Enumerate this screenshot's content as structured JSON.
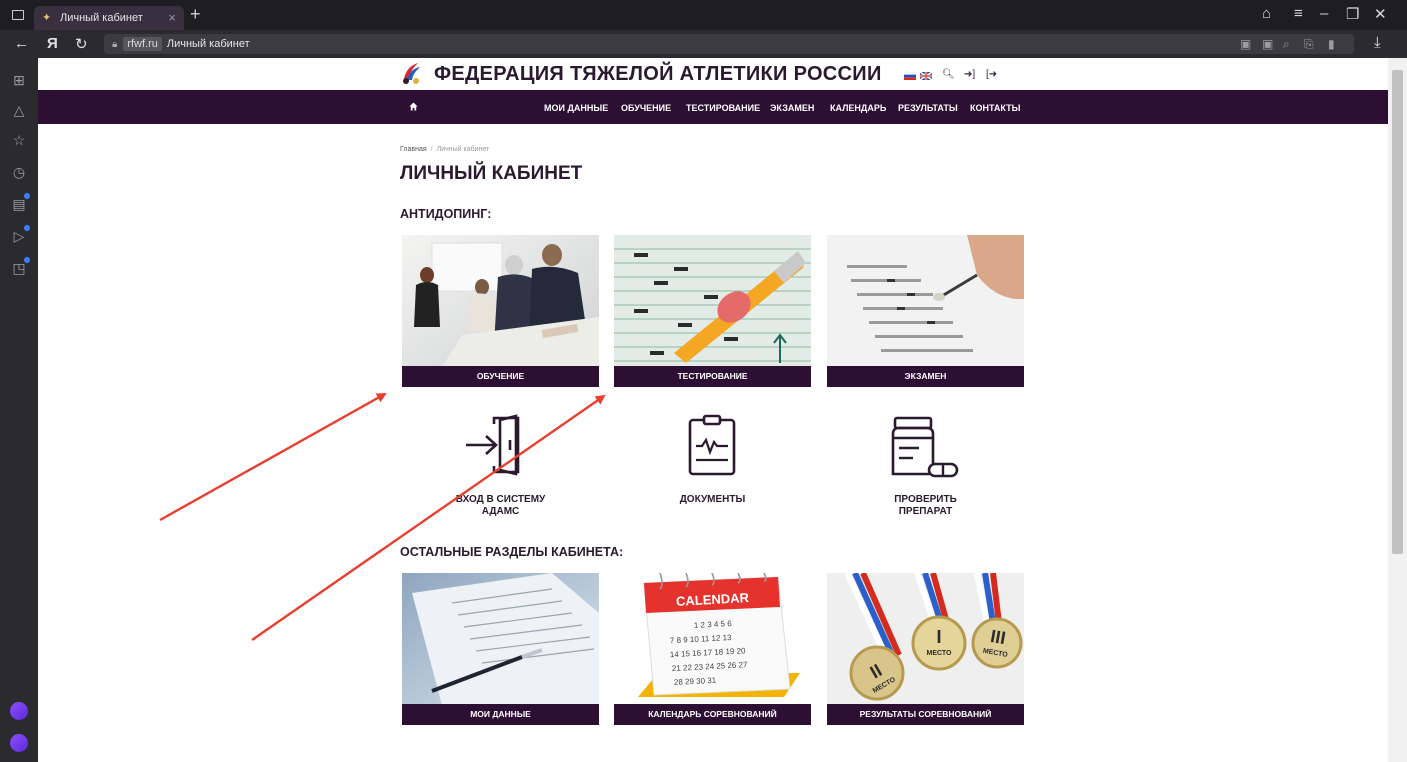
{
  "browser": {
    "tab_title": "Личный кабинет",
    "tab_close": "×",
    "new_tab": "+",
    "nav_back": "←",
    "nav_yandex": "Я",
    "nav_reload": "↻",
    "url_domain": "rfwf.ru",
    "url_title": "Личный кабинет",
    "download": "⤓"
  },
  "site": {
    "title": "ФЕДЕРАЦИЯ ТЯЖЕЛОЙ АТЛЕТИКИ РОССИИ",
    "colors": {
      "brand": "#2d0f34",
      "text": "#2b1930",
      "arrow": "#e8402e"
    }
  },
  "nav": {
    "items": [
      "МОИ ДАННЫЕ",
      "ОБУЧЕНИЕ",
      "ТЕСТИРОВАНИЕ",
      "ЭКЗАМЕН",
      "КАЛЕНДАРЬ",
      "РЕЗУЛЬТАТЫ",
      "КОНТАКТЫ"
    ]
  },
  "breadcrumb": {
    "home": "Главная",
    "sep": "/",
    "current": "Личный кабинет"
  },
  "page_title": "ЛИЧНЫЙ КАБИНЕТ",
  "antidoping": {
    "title": "АНТИДОПИНГ:",
    "cards": [
      "ОБУЧЕНИЕ",
      "ТЕСТИРОВАНИЕ",
      "ЭКЗАМЕН"
    ],
    "icon_tiles": [
      {
        "line1": "ВХОД В СИСТЕМУ",
        "line2": "АДАМС"
      },
      {
        "line1": "ДОКУМЕНТЫ",
        "line2": ""
      },
      {
        "line1": "ПРОВЕРИТЬ",
        "line2": "ПРЕПАРАТ"
      }
    ]
  },
  "other": {
    "title": "ОСТАЛЬНЫЕ РАЗДЕЛЫ КАБИНЕТА:",
    "cards": [
      "МОИ ДАННЫЕ",
      "КАЛЕНДАРЬ СОРЕВНОВАНИЙ",
      "РЕЗУЛЬТАТЫ СОРЕВНОВАНИЙ"
    ],
    "calendar_word": "CALENDAR",
    "calendar_rows": [
      "1  2  3  4  5  6",
      "7  8  9  10 11 12 13",
      "14 15 16 17 18 19 20",
      "21 22 23 24 25 26 27",
      "28 29 30 31"
    ],
    "medal_roman": [
      "II",
      "I",
      "III"
    ],
    "medal_word": "МЕСТО"
  }
}
